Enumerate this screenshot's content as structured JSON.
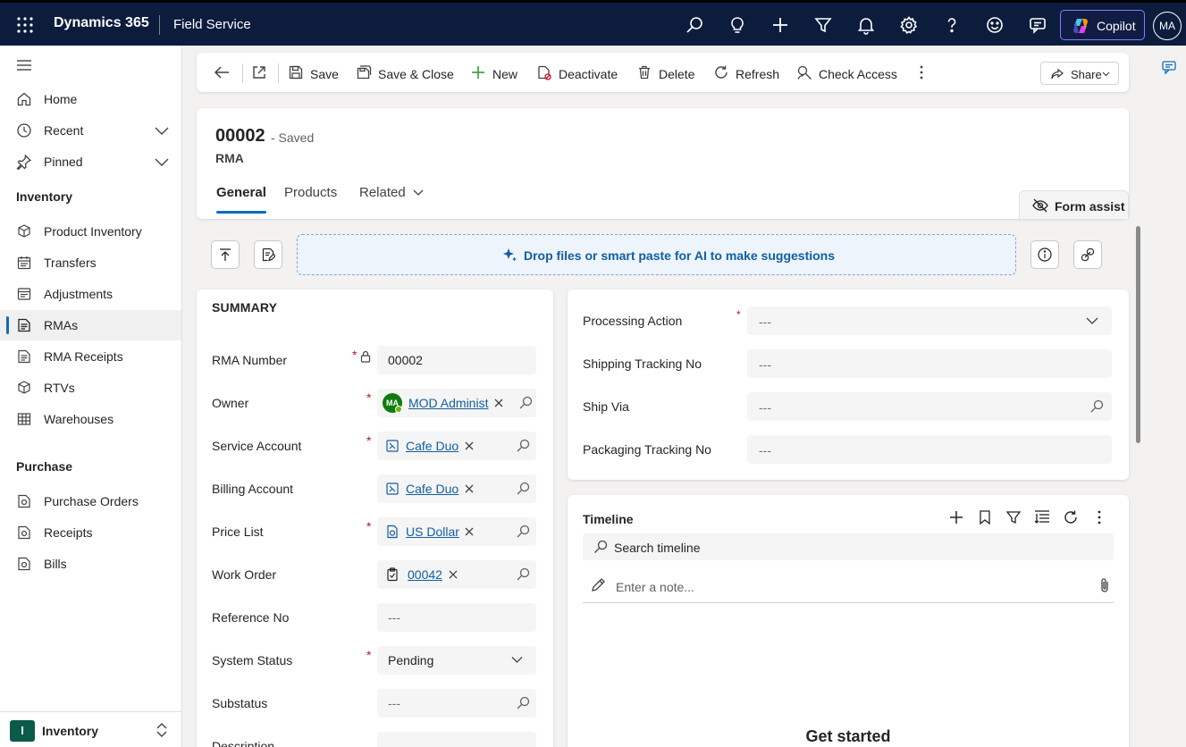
{
  "topbar": {
    "app_name": "Dynamics 365",
    "module": "Field Service",
    "copilot_label": "Copilot",
    "user_initials": "MA"
  },
  "sidebar": {
    "top_items": [
      {
        "label": "Home",
        "icon": "home-icon"
      },
      {
        "label": "Recent",
        "icon": "clock-icon"
      },
      {
        "label": "Pinned",
        "icon": "pin-icon"
      }
    ],
    "groups": [
      {
        "title": "Inventory",
        "items": [
          {
            "label": "Product Inventory",
            "icon": "cube-icon"
          },
          {
            "label": "Transfers",
            "icon": "calendar-icon"
          },
          {
            "label": "Adjustments",
            "icon": "document-icon"
          },
          {
            "label": "RMAs",
            "icon": "form-icon",
            "active": true
          },
          {
            "label": "RMA Receipts",
            "icon": "document-icon"
          },
          {
            "label": "RTVs",
            "icon": "cube-icon"
          },
          {
            "label": "Warehouses",
            "icon": "grid-icon"
          }
        ]
      },
      {
        "title": "Purchase",
        "items": [
          {
            "label": "Purchase Orders",
            "icon": "document-icon"
          },
          {
            "label": "Receipts",
            "icon": "document-icon"
          },
          {
            "label": "Bills",
            "icon": "document-icon"
          }
        ]
      }
    ],
    "area": {
      "badge": "I",
      "label": "Inventory"
    }
  },
  "commandbar": {
    "save": "Save",
    "save_close": "Save & Close",
    "new": "New",
    "deactivate": "Deactivate",
    "delete": "Delete",
    "refresh": "Refresh",
    "check_access": "Check Access",
    "share": "Share"
  },
  "record": {
    "title": "00002",
    "status": "- Saved",
    "entity": "RMA",
    "tabs": [
      "General",
      "Products",
      "Related"
    ],
    "form_assist": "Form assist"
  },
  "dropzone": {
    "label": "Drop files or smart paste for AI to make suggestions"
  },
  "summary": {
    "title": "SUMMARY",
    "fields": {
      "rma_number": {
        "label": "RMA Number",
        "value": "00002"
      },
      "owner": {
        "label": "Owner",
        "value": "MOD Administ",
        "initials": "MA"
      },
      "service_account": {
        "label": "Service Account",
        "value": "Cafe Duo"
      },
      "billing_account": {
        "label": "Billing Account",
        "value": "Cafe Duo"
      },
      "price_list": {
        "label": "Price List",
        "value": "US Dollar"
      },
      "work_order": {
        "label": "Work Order",
        "value": "00042"
      },
      "reference_no": {
        "label": "Reference No",
        "value": "---"
      },
      "system_status": {
        "label": "System Status",
        "value": "Pending"
      },
      "substatus": {
        "label": "Substatus",
        "value": "---"
      },
      "description": {
        "label": "Description",
        "value": ""
      }
    },
    "required_mark": "*"
  },
  "shipping": {
    "processing_action": {
      "label": "Processing Action",
      "value": "---"
    },
    "shipping_tracking_no": {
      "label": "Shipping Tracking No",
      "value": "---"
    },
    "ship_via": {
      "label": "Ship Via",
      "value": "---"
    },
    "packaging_tracking_no": {
      "label": "Packaging Tracking No",
      "value": "---"
    }
  },
  "timeline": {
    "title": "Timeline",
    "search_placeholder": "Search timeline",
    "note_placeholder": "Enter a note...",
    "empty_title": "Get started"
  },
  "colors": {
    "topbar": "#0b1c3d",
    "accent": "#0f6cbd",
    "link": "#115ea3",
    "required": "#c50f1f"
  }
}
